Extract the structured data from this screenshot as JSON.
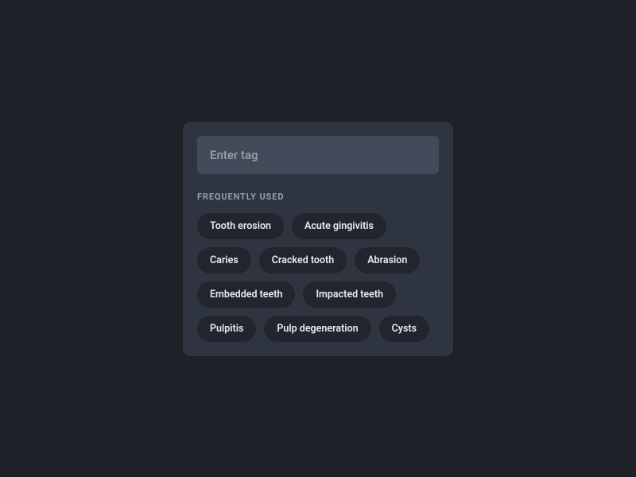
{
  "input": {
    "placeholder": "Enter tag",
    "value": ""
  },
  "section_label": "FREQUENTLY USED",
  "tags": [
    "Tooth erosion",
    "Acute gingivitis",
    "Caries",
    "Cracked tooth",
    "Abrasion",
    "Embedded teeth",
    "Impacted teeth",
    "Pulpitis",
    "Pulp degeneration",
    "Cysts"
  ]
}
